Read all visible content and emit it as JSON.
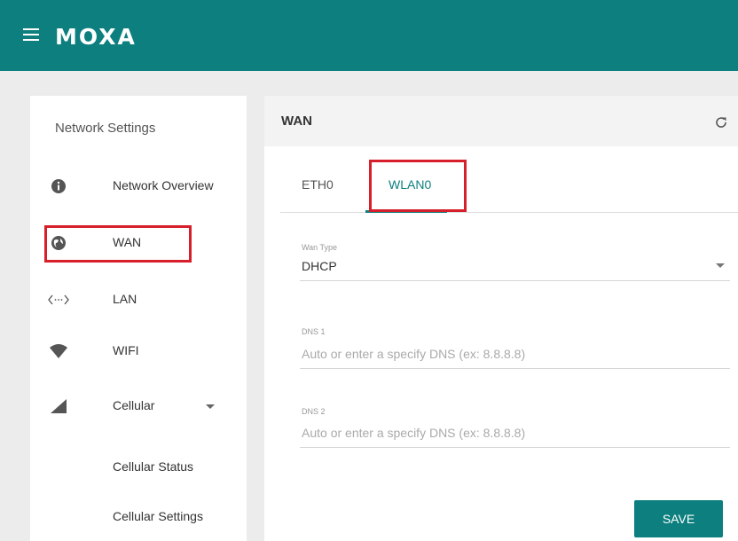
{
  "app": {
    "logo_text": "MOXA"
  },
  "sidebar": {
    "title": "Network Settings",
    "items": [
      {
        "label": "Network Overview",
        "icon": "info-icon"
      },
      {
        "label": "WAN",
        "icon": "globe-icon"
      },
      {
        "label": "LAN",
        "icon": "lan-arrows-icon"
      },
      {
        "label": "WIFI",
        "icon": "wifi-icon"
      },
      {
        "label": "Cellular",
        "icon": "cellular-signal-icon"
      },
      {
        "label": "Cellular Status"
      },
      {
        "label": "Cellular Settings"
      }
    ]
  },
  "panel": {
    "title": "WAN",
    "tabs": [
      {
        "label": "ETH0"
      },
      {
        "label": "WLAN0"
      }
    ],
    "active_tab": "WLAN0",
    "wan_type": {
      "label": "Wan Type",
      "value": "DHCP"
    },
    "dns1": {
      "label": "DNS 1",
      "placeholder": "Auto or enter a specify DNS (ex: 8.8.8.8)"
    },
    "dns2": {
      "label": "DNS 2",
      "placeholder": "Auto or enter a specify DNS (ex: 8.8.8.8)"
    },
    "save_label": "SAVE"
  },
  "colors": {
    "brand": "#0d7f7f",
    "highlight": "#d61f2a"
  }
}
